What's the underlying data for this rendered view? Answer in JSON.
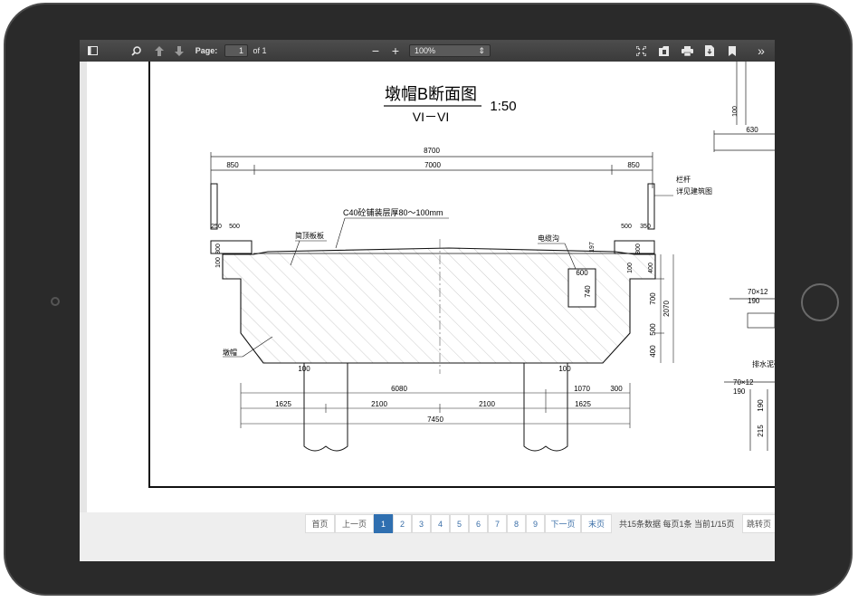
{
  "toolbar": {
    "page_label": "Page:",
    "page_value": "1",
    "page_total": "of 1",
    "zoom_value": "100%",
    "icons": [
      "sidebar-toggle-icon",
      "search-icon",
      "arrow-up-icon",
      "arrow-down-icon",
      "zoom-out-icon",
      "zoom-in-icon",
      "fullscreen-icon",
      "open-file-icon",
      "print-icon",
      "download-icon",
      "bookmark-icon",
      "more-tools-icon"
    ],
    "zoom_out_glyph": "−",
    "zoom_in_glyph": "+",
    "more_glyph": "»"
  },
  "drawing": {
    "title": "墩帽B断面图",
    "subtitle": "VI－VI",
    "scale": "1:50",
    "overall_width": "8700",
    "side_dim_left": "850",
    "center_dim": "7000",
    "side_dim_right": "850",
    "label_pavement": "C40砼铺装层厚80～100mm",
    "label_slab": "简顶板板",
    "label_cable_trench": "电缆沟",
    "label_railing": "栏杆",
    "label_railing_note": "详见建筑图",
    "label_cap": "墩帽",
    "dim_500_left": "500",
    "dim_500_right": "500",
    "dim_250": "250",
    "dim_350": "350",
    "dim_300_left": "300",
    "dim_300_right": "300",
    "dim_100_left": "100",
    "dim_100_right": "100",
    "dim_197": "197",
    "dim_600": "600",
    "dim_740": "740",
    "dim_400_top": "400",
    "dim_700": "700",
    "dim_500_mid": "500",
    "dim_400_bottom": "400",
    "dim_2070": "2070",
    "dim_100_pier_left": "100",
    "dim_100_pier_right": "100",
    "dim_6080": "6080",
    "dim_1070": "1070",
    "dim_300_b": "300",
    "dim_1625_left": "1625",
    "dim_2100_left": "2100",
    "dim_2100_right": "2100",
    "dim_1625_right": "1625",
    "dim_7450": "7450",
    "right_dim_100": "100",
    "right_dim_630": "630",
    "right_label_1": "70×12",
    "right_label_190a": "190",
    "right_label_pipe": "排水泥砂",
    "right_label_2": "70×12",
    "right_label_190b": "190",
    "right_label_190c": "190",
    "right_label_215": "215"
  },
  "pagination": {
    "first": "首页",
    "prev": "上一页",
    "pages": [
      "1",
      "2",
      "3",
      "4",
      "5",
      "6",
      "7",
      "8",
      "9"
    ],
    "current": "1",
    "next": "下一页",
    "last": "末页",
    "info": "共15条数据 每页1条 当前1/15页",
    "jump": "跳转页"
  }
}
